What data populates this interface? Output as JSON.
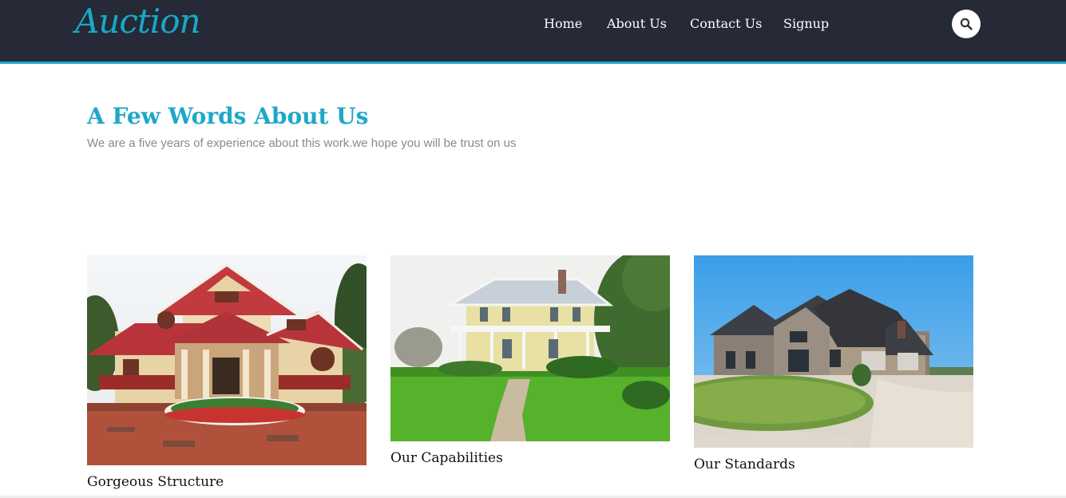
{
  "brand": {
    "logo_text": "Auction",
    "accent_color": "#1ea7c8",
    "header_color": "#252a36"
  },
  "nav": {
    "items": [
      {
        "label": "Home"
      },
      {
        "label": "About Us"
      },
      {
        "label": "Contact Us"
      },
      {
        "label": "Signup"
      }
    ],
    "search_icon": "search-icon"
  },
  "intro": {
    "title": "A Few Words About Us",
    "text": "We are a five years of experience about this work.we hope you will be trust on us"
  },
  "cards": [
    {
      "caption": "Gorgeous Structure",
      "image": "red-roof-house-photo"
    },
    {
      "caption": "Our Capabilities",
      "image": "yellow-colonial-house-photo"
    },
    {
      "caption": "Our Standards",
      "image": "stone-house-photo"
    }
  ]
}
